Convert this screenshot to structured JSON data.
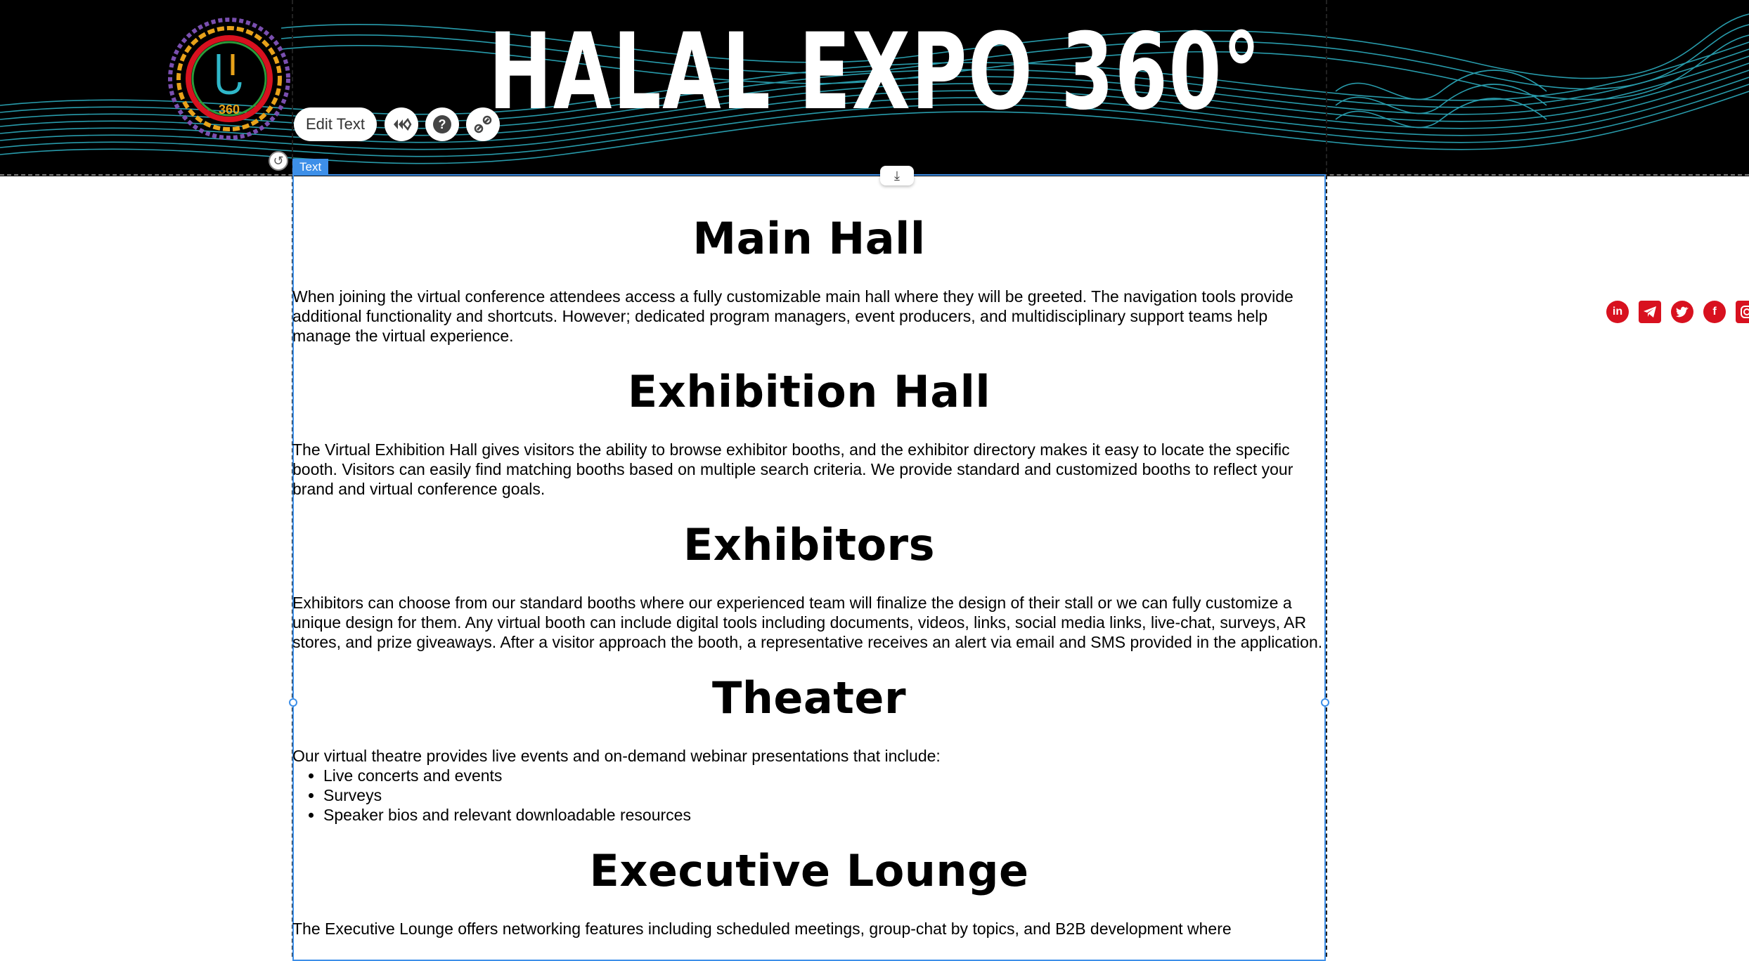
{
  "banner": {
    "title": "HALAL EXPO 360°",
    "logo_text": "360",
    "colors": {
      "background": "#000000",
      "wave": "#2fb7c9",
      "logo_ring": "#e8a21a",
      "logo_red": "#d8111f"
    }
  },
  "editor": {
    "edit_text_label": "Edit Text",
    "text_tag_label": "Text",
    "tools": [
      "animation-icon",
      "help-icon",
      "link-icon"
    ],
    "accent": "#3d8fe8"
  },
  "sections": [
    {
      "heading": "Main Hall",
      "paragraph": "When joining the virtual conference attendees access a fully customizable main hall where they will be greeted. The navigation tools provide additional functionality and shortcuts. However; dedicated program managers, event producers, and multidisciplinary support teams help manage the virtual experience."
    },
    {
      "heading": "Exhibition Hall",
      "paragraph": "The Virtual Exhibition Hall gives visitors the ability to browse exhibitor booths, and the exhibitor directory makes it easy to locate the specific booth. Visitors can easily find matching booths based on multiple search criteria. We provide standard and customized booths to reflect your brand and virtual conference goals."
    },
    {
      "heading": "Exhibitors",
      "paragraph": "Exhibitors can choose from our standard booths where our experienced team will finalize the design of their stall or we can fully customize a unique design for them. Any virtual booth can include digital tools including documents, videos, links, social media links, live-chat, surveys, AR stores, and prize giveaways. After a visitor approach the booth, a representative receives an alert via email and SMS provided in the application."
    },
    {
      "heading": "Theater",
      "paragraph": "Our virtual theatre provides live events and on-demand webinar presentations that include:",
      "bullets": [
        "Live concerts and events",
        "Surveys",
        "Speaker bios and relevant downloadable resources"
      ]
    },
    {
      "heading": "Executive Lounge",
      "paragraph": "The Executive Lounge offers networking features including scheduled meetings, group-chat by topics, and B2B development where"
    }
  ],
  "social": {
    "icons": [
      "linkedin-icon",
      "telegram-icon",
      "twitter-icon",
      "facebook-icon",
      "instagram-icon"
    ],
    "color": "#d8111f"
  }
}
